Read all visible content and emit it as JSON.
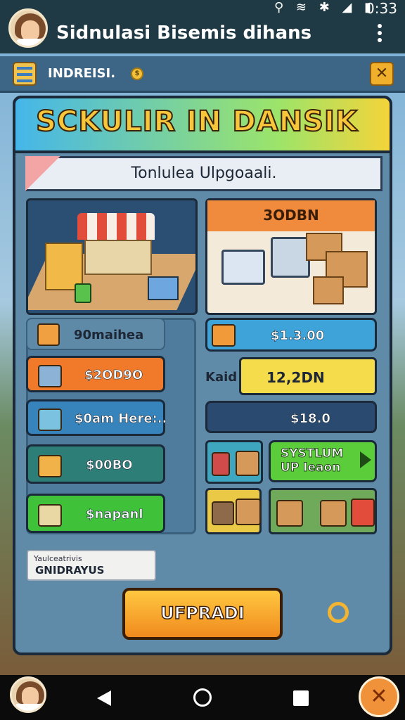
{
  "status_bar": {
    "time": "0:33",
    "icons": "⚲ ≋ ✱ ◢ ▮"
  },
  "app_bar": {
    "title": "Sidnulasi Bisemis dihans"
  },
  "top_bar": {
    "label": "INDREISI.",
    "coin_symbol": "$",
    "close_symbol": "✕"
  },
  "panel": {
    "title": "SCKULIR IN DANSIK",
    "subtitle": "Tonlulea Ulpgoaali.",
    "warehouse_label": "3ODBN"
  },
  "left_rows": [
    {
      "label": "90maihea"
    },
    {
      "label": "$2OD9O"
    },
    {
      "label": "$0am Here:.."
    },
    {
      "label": "$00BO"
    },
    {
      "label": "$napanl"
    }
  ],
  "right_rows": {
    "price1": "$1.3.00",
    "side_label": "Kaid",
    "price2": "12,2DN",
    "price3": "$18.0",
    "system_button": "SYSTLUM\nUP Ieaon"
  },
  "note": {
    "small": "Yaulceatrivis",
    "main": "GNIDRAYUS"
  },
  "upgrade_button": {
    "label": "UFPRADI"
  },
  "colors": {
    "accent": "#f5a623",
    "panel": "#5f8ba9",
    "banner_text": "#f7c63a"
  }
}
